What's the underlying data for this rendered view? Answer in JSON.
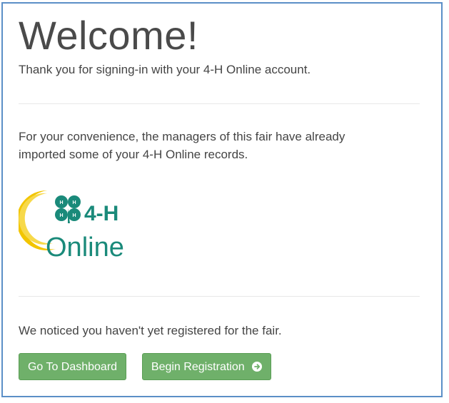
{
  "welcome": {
    "title": "Welcome!",
    "signin_text": "Thank you for signing-in with your 4-H Online account.",
    "import_text": "For your convenience, the managers of this fair have already imported some of your 4-H Online records.",
    "logo": {
      "line1": "4-H",
      "line2": "Online",
      "icon": "4h-clover-logo"
    },
    "notice_text": "We noticed you haven't yet registered for the fair.",
    "buttons": {
      "dashboard_label": "Go To Dashboard",
      "register_label": "Begin Registration",
      "register_icon": "arrow-circle-right-icon"
    }
  },
  "colors": {
    "button_green": "#6fb06a",
    "logo_teal": "#1a8a7a",
    "logo_yellow": "#f2c500",
    "frame_border": "#5b8fc7"
  }
}
